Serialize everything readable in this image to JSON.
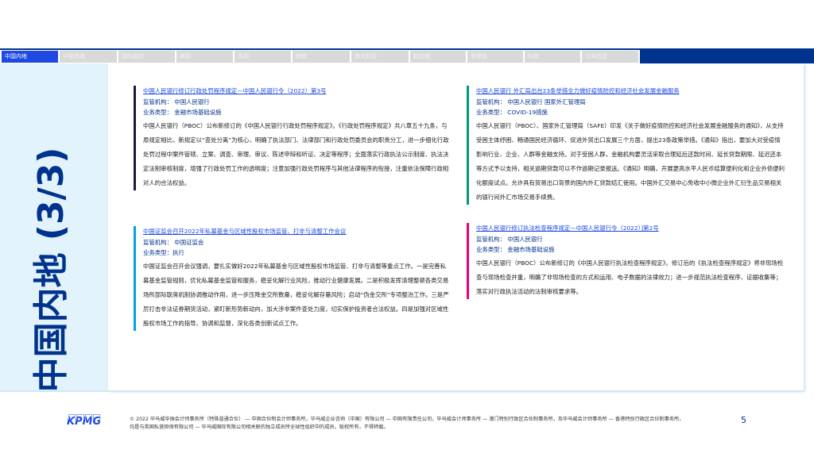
{
  "tabs": [
    "中国内地",
    "中国香港",
    "国际组织",
    "美国",
    "英国",
    "欧盟",
    "澳大利亚",
    "新加坡",
    "菲律宾",
    "印度",
    "马来西亚"
  ],
  "active_tab": "中国内地",
  "section_title": "中国内地 (3/3)",
  "cards": [
    {
      "title": "中国人民银行修订行政处罚程序规定—中国人民银行令（2022）第3号",
      "regulator": "监管机构：  中国人民银行",
      "type": "业务类型：  金融市场基础设施",
      "body": "中国人民银行（PBOC）公布新修订的《中国人民银行行政处罚程序规定》。《行政处罚程序规定》共八章五十九条，与原规定相比，新规定以“查处分离”为核心，明确了执法部门、法律部门和行政处罚委员会的职责分工，进一步细化行政处罚过程中案件管辖、立案、调查、审理、审议、陈述申辩和听证、决定等程序；全面落实行政执法公示制度、执法决定法制审核制度，增强了行政处罚工作的透明度；注意加强行政处罚程序与其他法律程序的衔接，注重依法保障行政相对人的合法权益。",
      "color": "#1a1a3a"
    },
    {
      "title": "中国证监会召开2022年私募基金与区域性股权市场监管、打非与清整工作会议",
      "regulator": "监管机构：  中国证监会",
      "type": "业务类型：执行",
      "body": "中国证监会召开会议强调，要扎实做好2022年私募基金与区域性股权市场监管、打非与清整等重点工作。一是完善私募基金监管规则，优化私募基金监管和服务，稳妥化解行业风险，推动行业健康发展。二是积极发挥清理整顿各类交易场所部际联席机制协调推动作用，进一步压降金交所数量，稳妥化解存量风险；启动“伪金交所”专项整治工作。三是严厉打击非法证券期货活动，紧盯新形势新动向，加大涉非案件查处力度，切实保护投资者合法权益。四是加强对区域性股权市场工作的指导、协调和监督，深化各类创新试点工作。",
      "color": "#00a3e0"
    },
    {
      "title": "中国人民银行 外汇局出台23条举措全力做好疫情防控和经济社会发展金融服务",
      "regulator": "监管机构：  中国人民银行 国家外汇管理局",
      "type": "业务类型：  COVID-19措施",
      "body": "中国人民银行（PBOC）、国家外汇管理局（SAFE）印发《关于做好疫情防控和经济社会发展金融服务的通知》，从支持受困主体纾困、畅通国民经济循环、促进外贸出口发展三个方面，提出23条政策举措。《通知》指出，要加大对受疫情影响行业、企业、人群等金融支持。对于受困人群，金融机构要灵活采取合理延后还款时间、延长贷款期限、延迟还本等方式予以支持，相关逾期贷款可以不作逾期记录报送。《通知》明确，开展更高水平人民币结算便利化和企业外债便利化额度试点。允许具有贸易出口背景的国内外汇贷款结汇使用。中国外汇交易中心免收中小微企业外汇衍生品交易相关的银行间外汇市场交易手续费。",
      "color": "#009a7b"
    },
    {
      "title": "中国人民银行修订执法检查程序规定—中国人民银行令（2022）]第2号",
      "regulator": "监管机构：  中国人民银行",
      "type": "业务类型：  金融市场基础设施",
      "body": "中国人民银行（PBOC）公布新修订的《中国人民银行执法检查程序规定》。修订后的《执法检查程序规定》将非现场检查与现场检查并重，明确了非现场检查的方式和运用、电子数据的法律效力；进一步规范执法检查程序、证据收集等；落实对行政执法活动的法制审核要求等。",
      "color": "#e6007e"
    }
  ],
  "footer": "© 2022 毕马威华振会计师事务所（特殊普通合伙） — 中国合伙制会计师事务所，毕马威企业咨询（中国）有限公司 — 中国有限责任公司，毕马威会计师事务所 — 澳门特别行政区合伙制事务所，及毕马威会计师事务所 — 香港特别行政区合伙制事务所，均是与英国私营担保有限公司 — 毕马威国际有限公司相关联的独立成员所全球性组织中的成员。版权所有，不得转载。",
  "logo": "KPMG",
  "page_number": "5"
}
